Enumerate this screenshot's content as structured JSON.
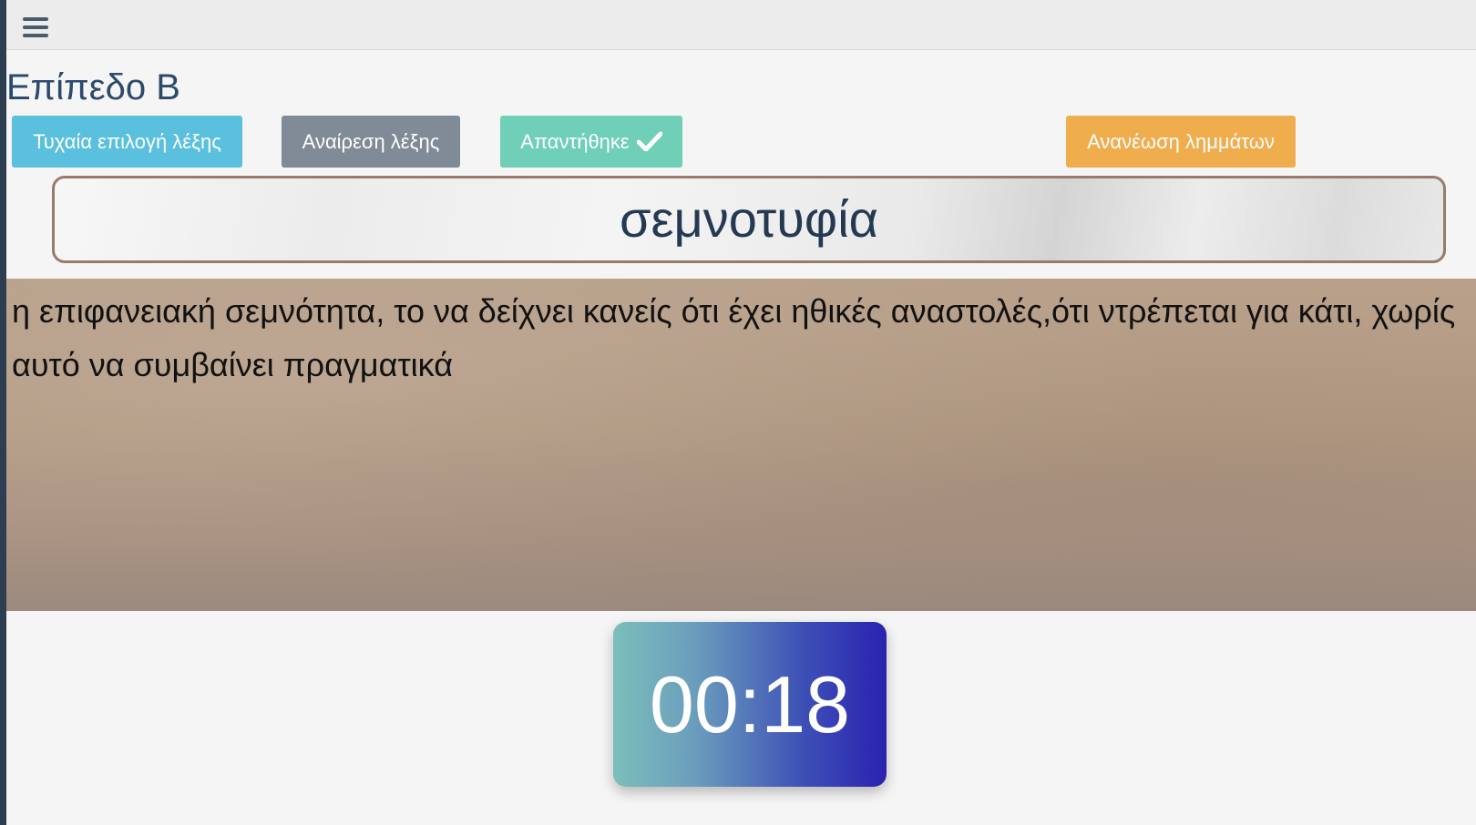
{
  "colors": {
    "sidebar_edge": "#2c3e50",
    "random_button": "#5bc0de",
    "remove_button": "#808b97",
    "answered_button": "#6fcfb7",
    "refresh_button": "#f0ad4e",
    "title_text": "#2c4a6b",
    "timer_gradient_start": "#7bbfbb",
    "timer_gradient_end": "#2a22b0"
  },
  "header": {
    "menu_icon": "hamburger-menu-icon"
  },
  "level": {
    "title": "Επίπεδο Β"
  },
  "toolbar": {
    "random_label": "Τυχαία επιλογή λέξης",
    "remove_label": "Αναίρεση λέξης",
    "answered_label": "Απαντήθηκε",
    "answered_icon": "checkmark-icon",
    "refresh_label": "Ανανέωση λημμάτων"
  },
  "word": {
    "text": "σεμνοτυφία"
  },
  "definition": {
    "text": "η επιφανειακή σεμνότητα, το να δείχνει κανείς ότι έχει ηθικές αναστολές,ότι ντρέπεται για κάτι, χωρίς αυτό να συμβαίνει πραγματικά"
  },
  "timer": {
    "display": "00:18"
  }
}
